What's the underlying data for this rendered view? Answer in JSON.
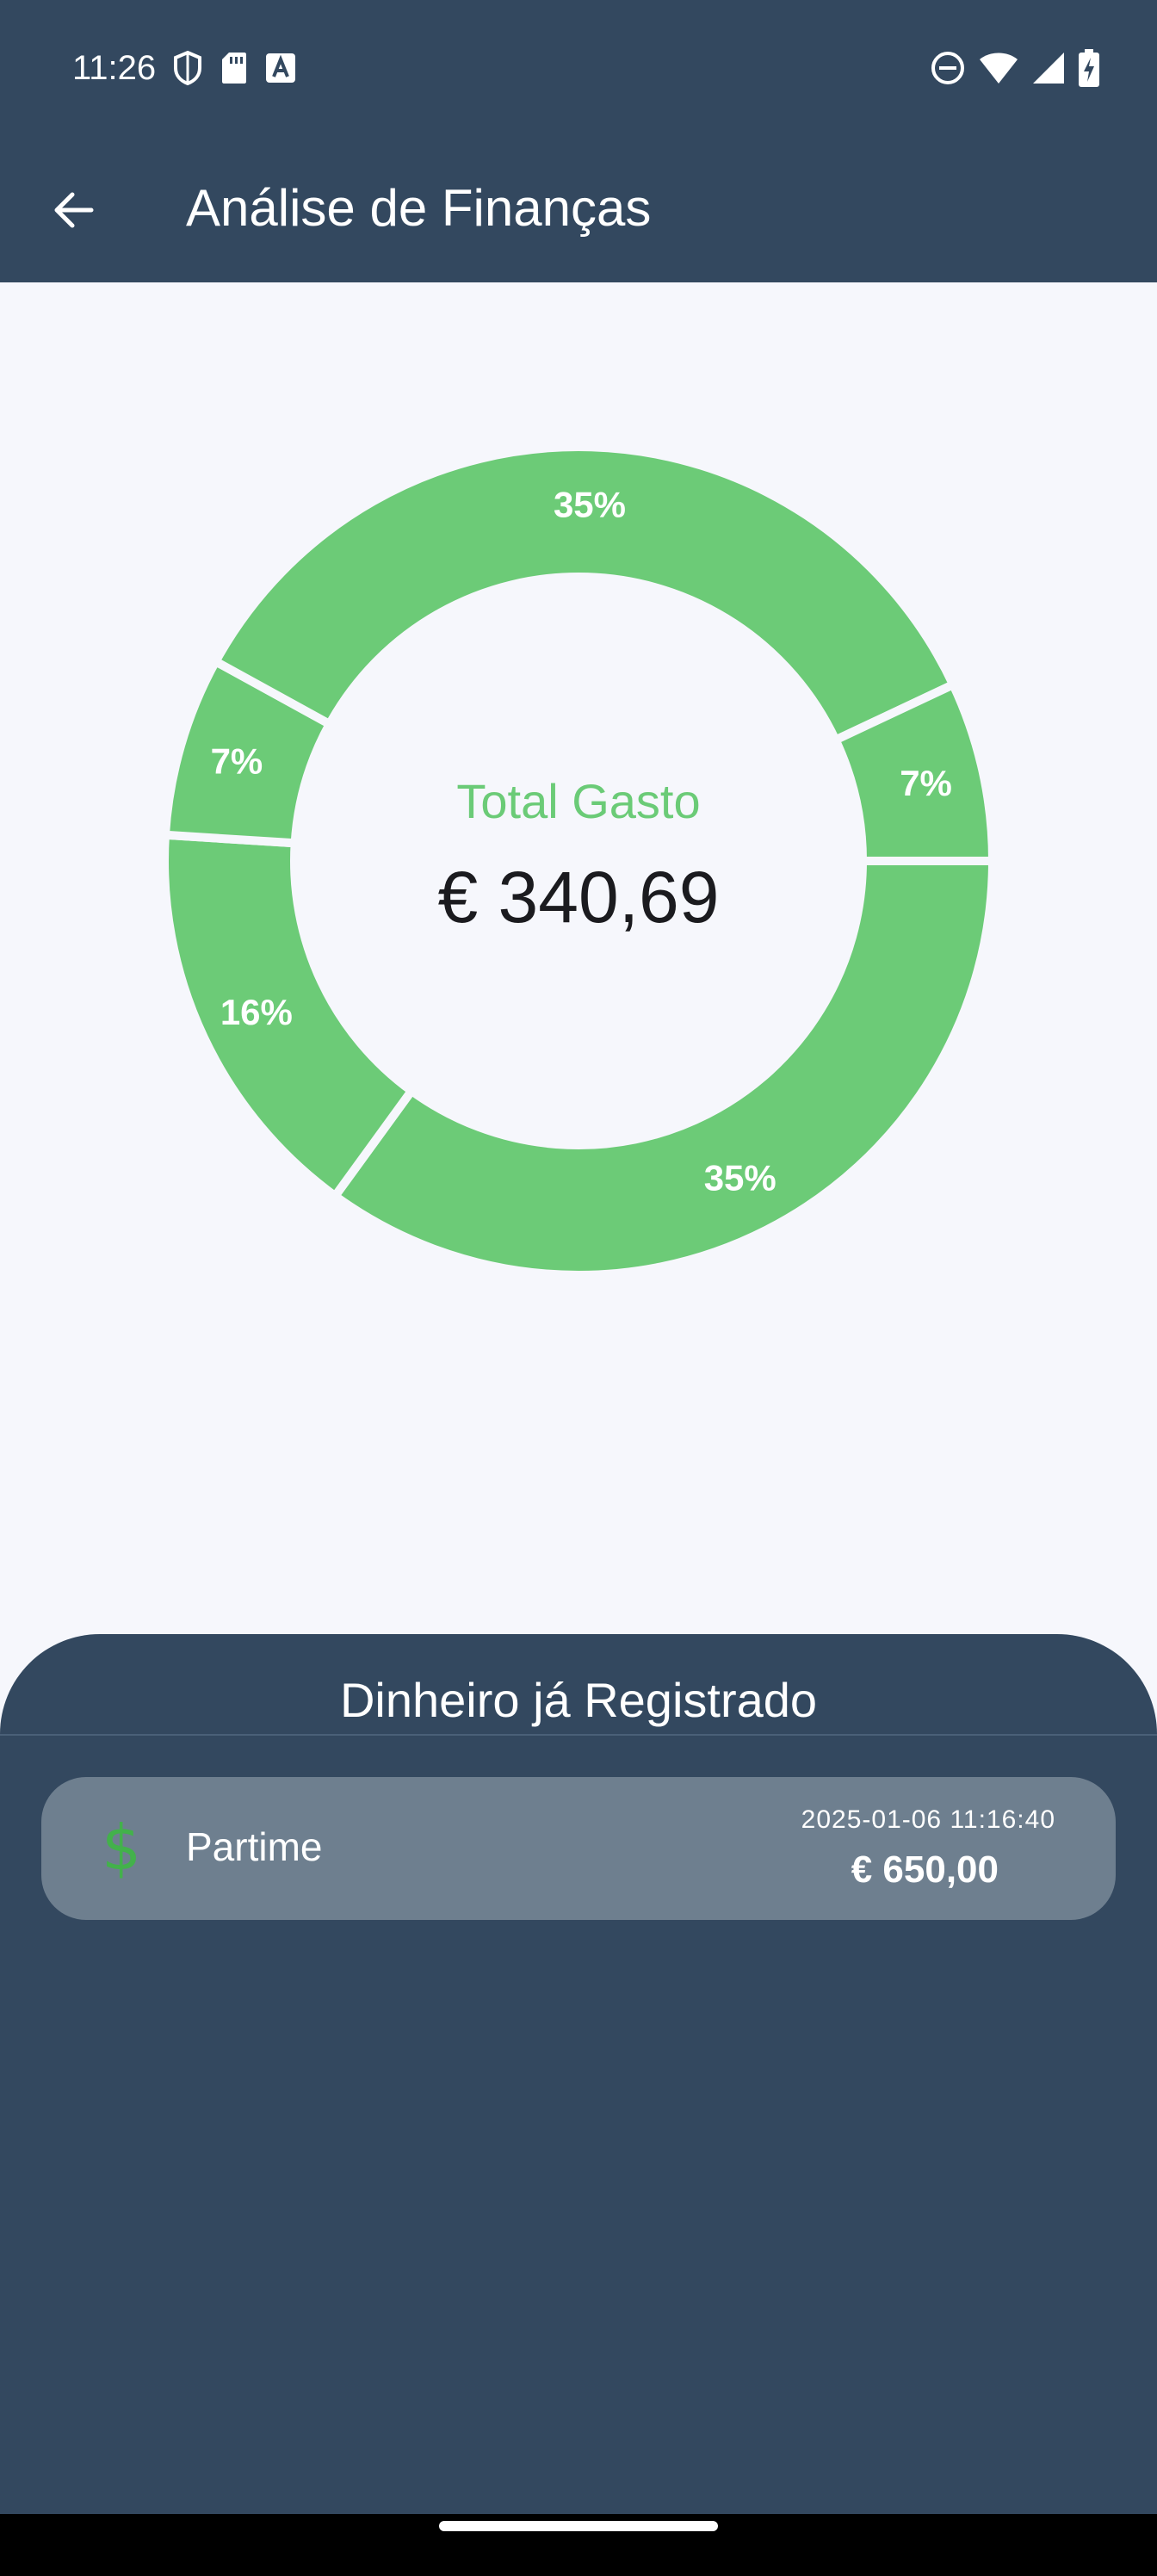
{
  "status_bar": {
    "time": "11:26",
    "icons_left": [
      "shield-icon",
      "sd-card-icon",
      "text-a-icon"
    ],
    "icons_right": [
      "do-not-disturb-icon",
      "wifi-icon",
      "signal-icon",
      "battery-charging-icon"
    ]
  },
  "app_bar": {
    "title": "Análise de Finanças",
    "back_icon": "arrow-left-icon"
  },
  "chart_data": {
    "type": "pie",
    "style": "donut",
    "values": [
      35,
      16,
      7,
      35,
      7
    ],
    "slice_labels": [
      "35%",
      "16%",
      "7%",
      "35%",
      "7%"
    ],
    "color": "#6CCB77",
    "center_title": "Total Gasto",
    "center_value": "€ 340,69"
  },
  "sheet": {
    "title": "Dinheiro já Registrado",
    "entries": [
      {
        "icon": "dollar-icon",
        "name": "Partime",
        "date": "2025-01-06 11:16:40",
        "amount": "€ 650,00"
      }
    ]
  },
  "colors": {
    "primary": "#33485F",
    "background": "#F6F7FC",
    "accent_green": "#6CCB77",
    "card": "#6E7F8F"
  }
}
